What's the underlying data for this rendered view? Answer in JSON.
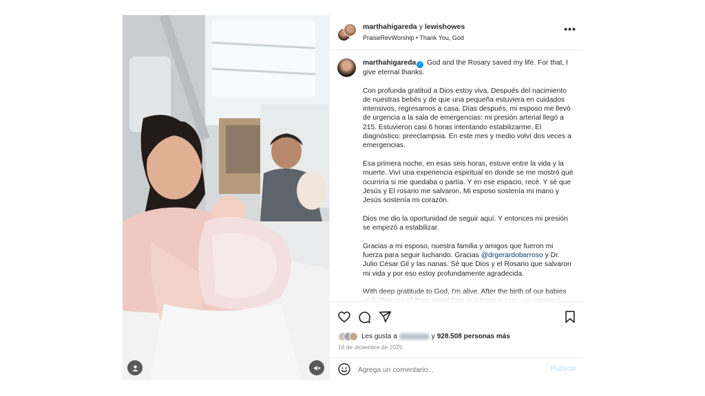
{
  "header": {
    "author_1": "marthahigareda",
    "joiner": "y",
    "author_2": "lewishowes",
    "audio": "PraiseRevWorship • Thank You, God",
    "more_label": "•••"
  },
  "caption": {
    "username": "marthahigareda",
    "verified_glyph": "✓",
    "first_line": "God and the Rosary saved my life. For that, I give eternal thanks.",
    "paragraphs": [
      "Con profunda gratitud a Dios estoy viva. Después del nacimiento de nuestras bebés y de que una pequeña estuviera en cuidados intensivos, regresamos a casa. Días después, mi esposo me llevó de urgencia a la sala de emergencias: mi presión arterial llegó a 215. Estuvieron casi 6 horas intentando estabilizarme. El diagnóstico: preeclampsia. En este mes y medio volví dos veces a emergencias.",
      "Esa primera noche, en esas seis horas, estuve entre la vida y la muerte. Viví una experiencia espiritual en donde se me mostró qué ocurriría si me quedaba o partía. Y en ese espacio, recé. Y sé que Jesús y El rosario me salvaron. Mi esposo sostenía mi mano y Jesús sostenía mi corazón.",
      "Dios me dio la oportunidad de seguir aquí. Y entonces mi presión se empezó a estabilizar."
    ],
    "thanks_before": "Gracias a mi esposo, nuestra familia y amigos que fueron mi fuerza para seguir luchando. Gracias",
    "thanks_mention": "@drgerardobarroso",
    "thanks_after": "y Dr. Julio César Gil y las nanas. Sé que Dios y el Rosario que salvaron mi vida y por eso estoy profundamente agradecida.",
    "english": "With deep gratitude to God, I'm alive. After the birth of our babies and after one of them spent time in intensive care, we returned home."
  },
  "likes": {
    "prefix": "Les gusta a",
    "connector": "y",
    "count_text": "928.508 personas más"
  },
  "date": "16 de diciembre de 2025",
  "comment": {
    "placeholder": "Agrega un comentario...",
    "publish_label": "Publicar"
  },
  "colors": {
    "link": "#00376b",
    "verified": "#0095f6",
    "publish": "#b2dffc",
    "muted": "#8e8e8e"
  },
  "icons": {
    "like": "heart-icon",
    "comment": "comment-icon",
    "share": "share-icon",
    "save": "bookmark-icon",
    "emoji": "smile-icon",
    "user_tag": "user-icon",
    "audio": "mute-icon"
  }
}
